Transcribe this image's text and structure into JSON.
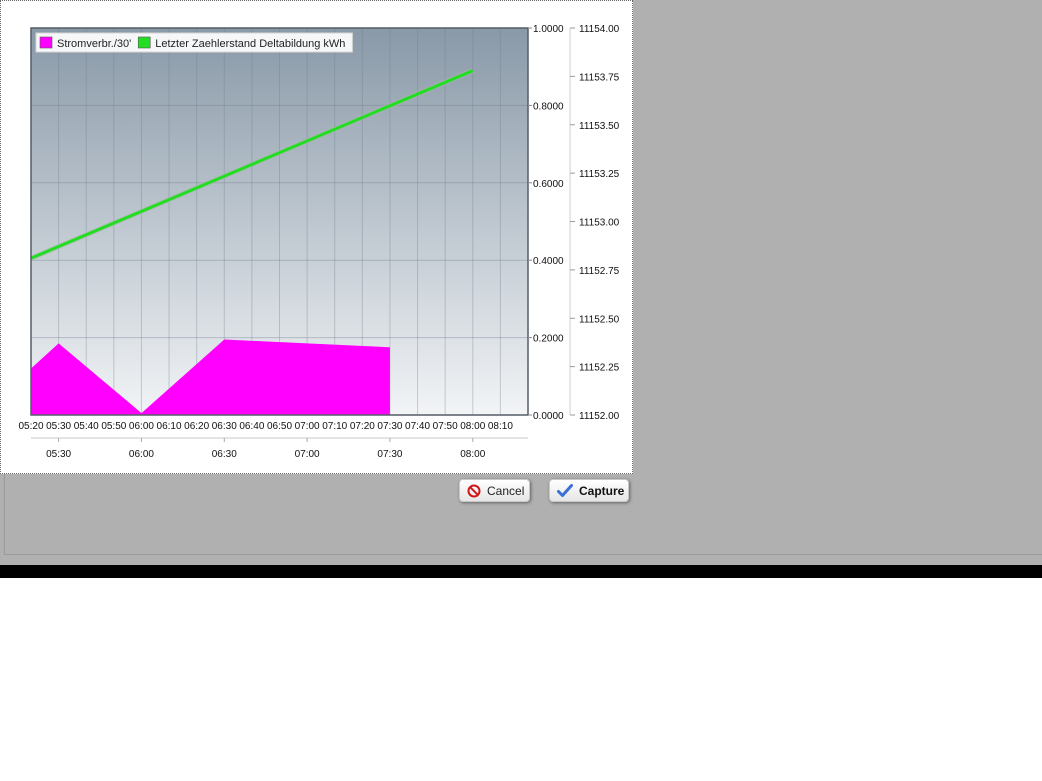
{
  "buttons": {
    "cancel_label": "Cancel",
    "capture_label": "Capture",
    "cancel_icon": "cancel-icon",
    "capture_icon": "checkmark-icon"
  },
  "colors": {
    "plot_gradient_top": "#8999a8",
    "plot_gradient_bottom": "#f2f4f6",
    "series_power": "#ff00ff",
    "series_meter": "#22dd22"
  },
  "chart_data": {
    "type": "area",
    "legend": {
      "placement": "top-left",
      "entries": [
        "Stromverbr./30'",
        "Letzter Zaehlerstand Deltabildung kWh"
      ]
    },
    "x_ticks": [
      "05:20",
      "05:30",
      "05:40",
      "05:50",
      "06:00",
      "06:10",
      "06:20",
      "06:30",
      "06:40",
      "06:50",
      "07:00",
      "07:10",
      "07:20",
      "07:30",
      "07:40",
      "07:50",
      "08:00",
      "08:10"
    ],
    "navigator_ticks": [
      "05:30",
      "06:00",
      "06:30",
      "07:00",
      "07:30",
      "08:00"
    ],
    "xlim": [
      "05:20",
      "08:20"
    ],
    "y_left": {
      "lim": [
        0,
        1
      ],
      "ticks": [
        "0.0000",
        "0.2000",
        "0.4000",
        "0.6000",
        "0.8000",
        "1.0000"
      ]
    },
    "y_right": {
      "lim": [
        11152.0,
        11154.0
      ],
      "ticks": [
        "11152.00",
        "11152.25",
        "11152.50",
        "11152.75",
        "11153.00",
        "11153.25",
        "11153.50",
        "11153.75",
        "11154.00"
      ]
    },
    "grid": true,
    "series": [
      {
        "name": "Stromverbr./30'",
        "type": "area",
        "axis": "left",
        "x": [
          "05:20",
          "05:30",
          "06:00",
          "06:30",
          "07:30"
        ],
        "values": [
          0.12,
          0.185,
          0.005,
          0.195,
          0.175
        ]
      },
      {
        "name": "Letzter Zaehlerstand Deltabildung kWh",
        "type": "line",
        "axis": "right",
        "x": [
          "05:20",
          "08:00"
        ],
        "values": [
          11152.81,
          11153.78
        ]
      }
    ]
  }
}
